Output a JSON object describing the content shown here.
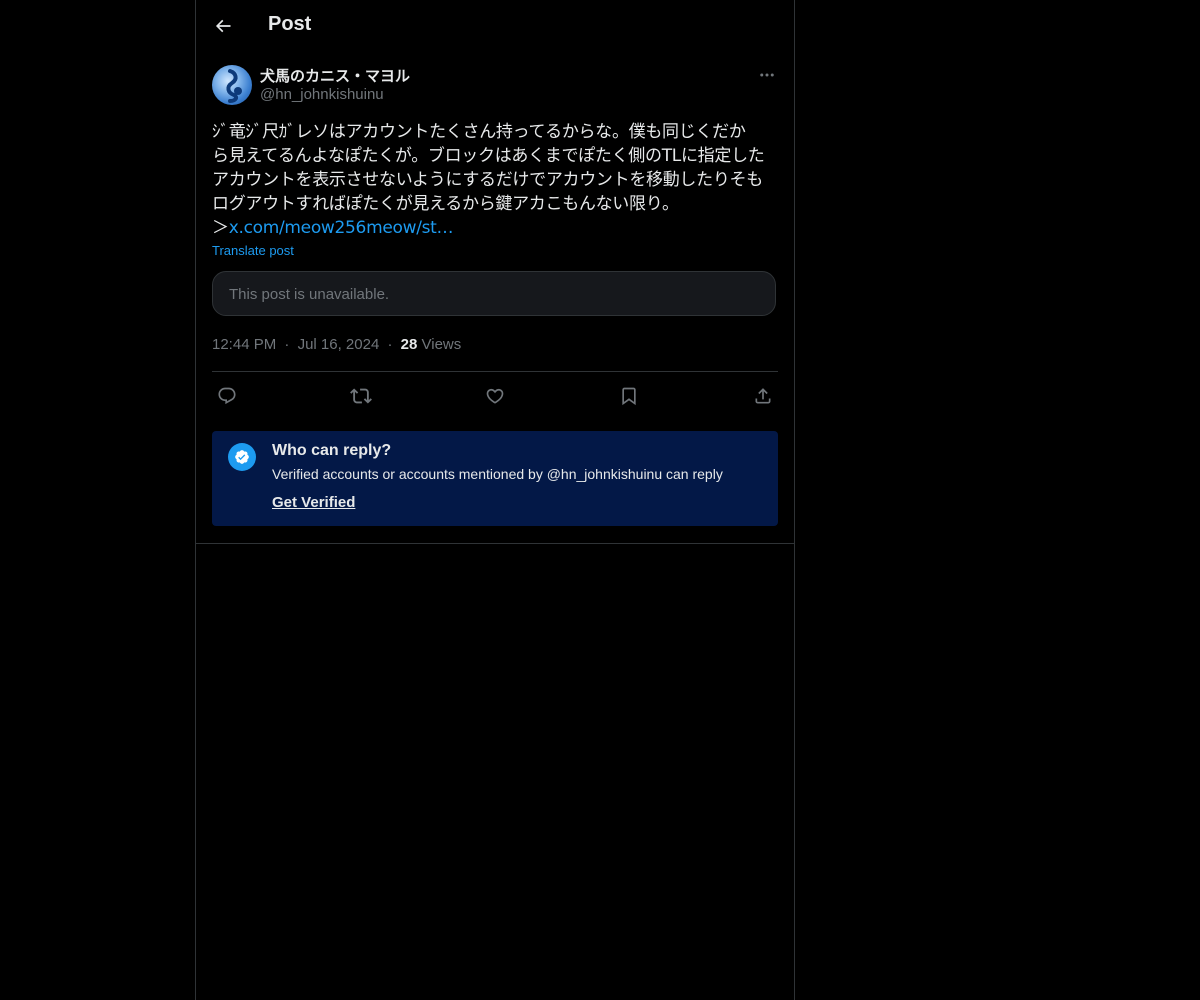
{
  "header": {
    "title": "Post",
    "back_icon": "arrow-left-icon"
  },
  "post": {
    "author_name": "犬馬のカニス・マヨル",
    "author_handle": "@hn_johnkishuinu",
    "text_lines": [
      "ｼﾞ竜ｼﾞ尺ｶﾞレソはアカウントたくさん持ってるからな。僕も同じくだか",
      "ら見えてるんよなぽたくが。ブロックはあくまでぽたく側のTLに指定した",
      "アカウントを表示させないようにするだけでアカウントを移動したりそも",
      "ログアウトすればぽたくが見えるから鍵アカこもんない限り。"
    ],
    "quote_prefix": "＞",
    "link_text": "x.com/meow256meow/st…",
    "translate_label": "Translate post",
    "unavailable_text": "This post is unavailable.",
    "time": "12:44 PM",
    "separator": "·",
    "date": "Jul 16, 2024",
    "views_count": "28",
    "views_label": "Views"
  },
  "actions": [
    {
      "name": "reply-icon"
    },
    {
      "name": "repost-icon"
    },
    {
      "name": "like-icon"
    },
    {
      "name": "bookmark-icon"
    },
    {
      "name": "share-icon"
    }
  ],
  "reply_restriction": {
    "title": "Who can reply?",
    "description": "Verified accounts or accounts mentioned by @hn_johnkishuinu can reply",
    "link": "Get Verified"
  },
  "colors": {
    "background": "#000000",
    "accent": "#1d9bf0",
    "reply_box_bg": "#031847",
    "muted_text": "#71767b",
    "border": "#2f3336"
  }
}
